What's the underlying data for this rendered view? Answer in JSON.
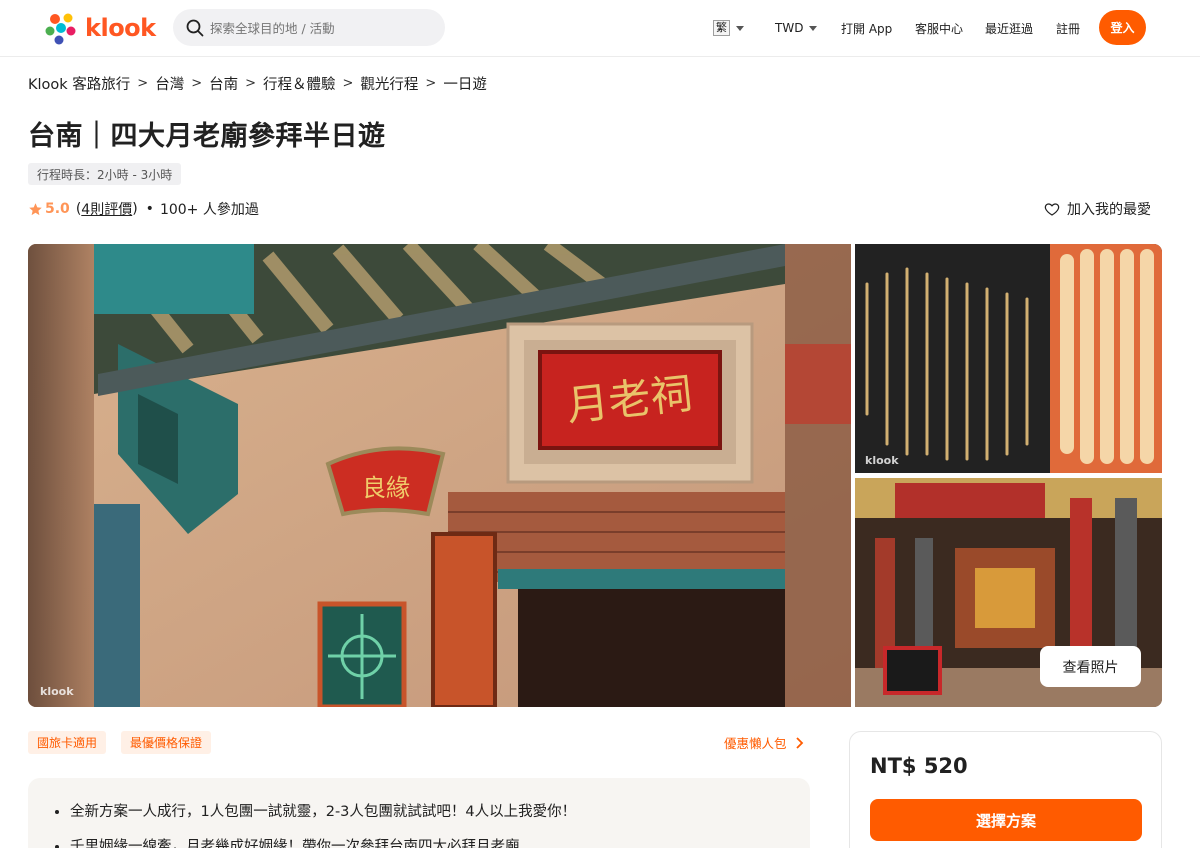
{
  "header": {
    "logo_text": "klook",
    "search_placeholder": "探索全球目的地 / 活動",
    "lang": "繁",
    "currency": "TWD",
    "app": "打開 App",
    "support": "客服中心",
    "recent": "最近逛過",
    "signup": "註冊",
    "login": "登入"
  },
  "breadcrumb": [
    "Klook 客路旅行",
    "台灣",
    "台南",
    "行程＆體驗",
    "觀光行程",
    "一日遊"
  ],
  "activity": {
    "title": "台南｜四大月老廟參拜半日遊",
    "duration": "行程時長：2小時 - 3小時",
    "score": "5.0",
    "paren_open": "(",
    "reviews": "4則評價",
    "paren_close": ")",
    "dot": "•",
    "participants": "100+ 人參加過",
    "favorite": "加入我的最愛"
  },
  "gallery": {
    "watermark": "klook",
    "view_photos": "查看照片",
    "plaque_main": "月老祠",
    "plaque_fan": "良緣"
  },
  "tags": [
    "國旅卡適用",
    "最優價格保證"
  ],
  "promo": "優惠懶人包",
  "highlights": [
    "全新方案一人成行，1人包團一試就靈，2-3人包團就試試吧！4人以上我愛你！",
    "千里姻緣一線牽，月老幾成好姻緣！帶你一次參拜台南四大必拜月老廟"
  ],
  "booking": {
    "price": "NT$ 520",
    "choose": "選擇方案"
  },
  "colors": {
    "brand": "#ff5b00",
    "star": "#ff9557"
  }
}
